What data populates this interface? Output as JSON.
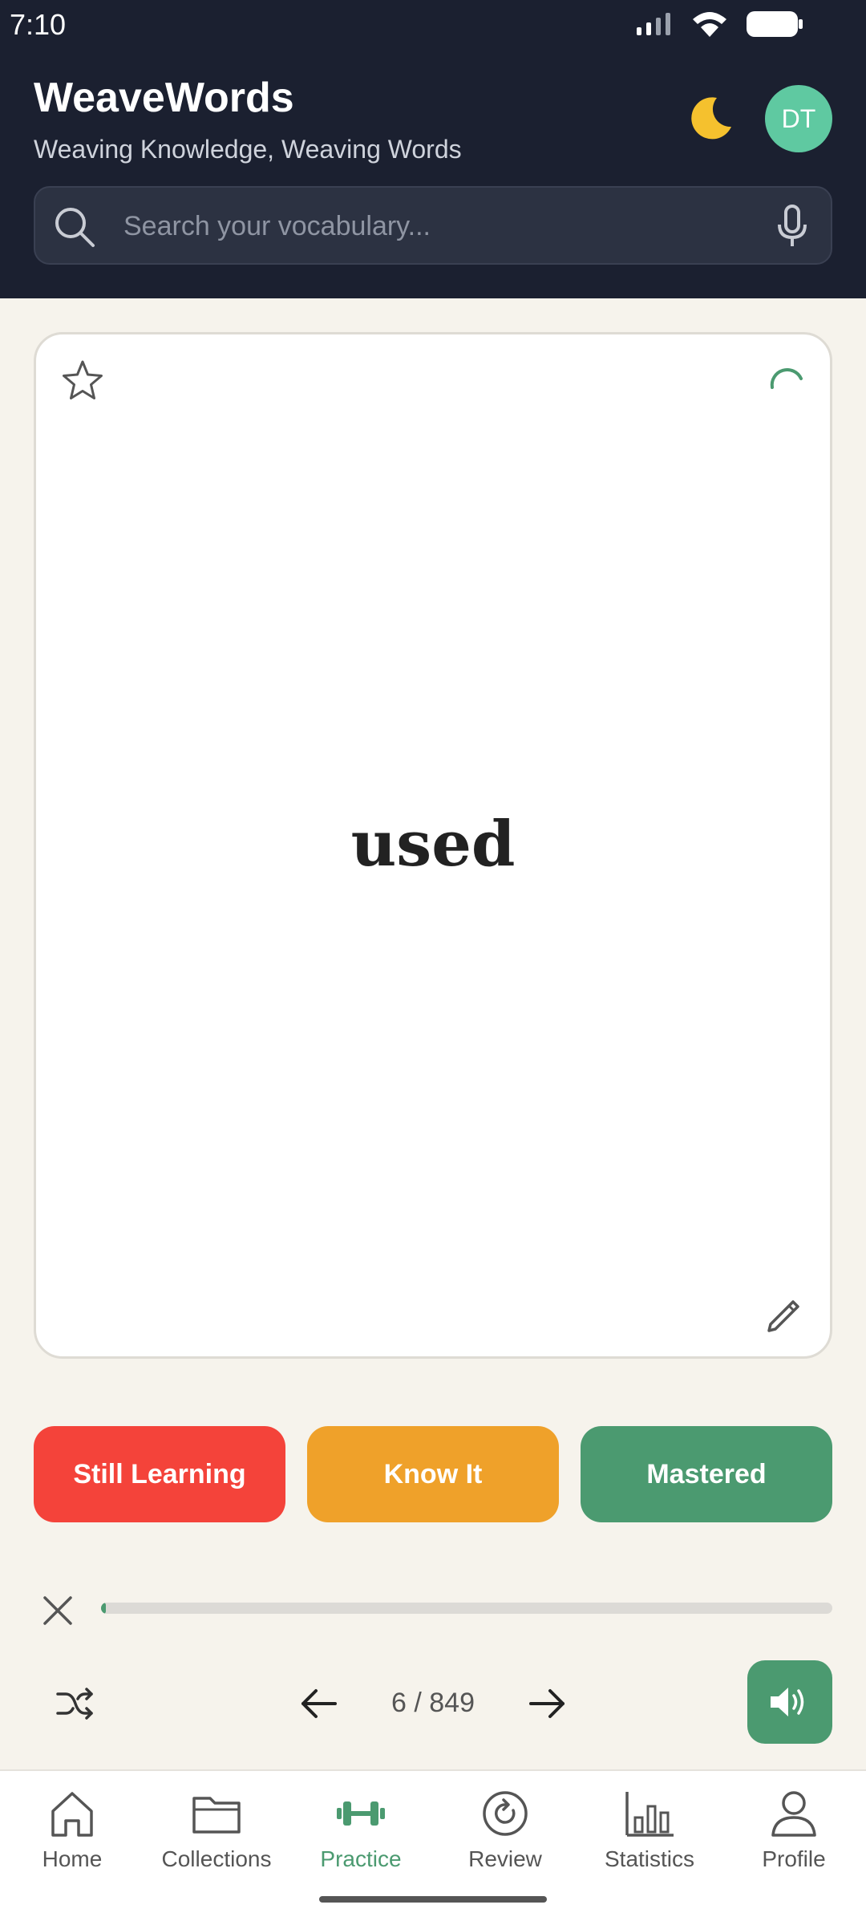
{
  "status_bar": {
    "time": "7:10"
  },
  "header": {
    "title": "WeaveWords",
    "subtitle": "Weaving Knowledge, Weaving Words",
    "avatar_initials": "DT",
    "theme_icon": "moon-icon"
  },
  "search": {
    "placeholder": "Search your vocabulary...",
    "value": ""
  },
  "card": {
    "word": "used"
  },
  "rating_buttons": {
    "still_learning": "Still Learning",
    "know_it": "Know It",
    "mastered": "Mastered"
  },
  "progress": {
    "fraction": 0.007
  },
  "navigation": {
    "counter": "6 / 849"
  },
  "bottom_nav": {
    "items": [
      {
        "label": "Home",
        "icon": "home-icon"
      },
      {
        "label": "Collections",
        "icon": "folder-icon"
      },
      {
        "label": "Practice",
        "icon": "dumbbell-icon",
        "active": true
      },
      {
        "label": "Review",
        "icon": "refresh-icon"
      },
      {
        "label": "Statistics",
        "icon": "bar-chart-icon"
      },
      {
        "label": "Profile",
        "icon": "person-icon"
      }
    ]
  },
  "colors": {
    "header_bg": "#1b2030",
    "accent_green": "#4b9a70",
    "still_learning": "#f4433a",
    "know_it": "#efa12a",
    "avatar": "#5fc9a1",
    "page_bg": "#f6f3ec"
  }
}
